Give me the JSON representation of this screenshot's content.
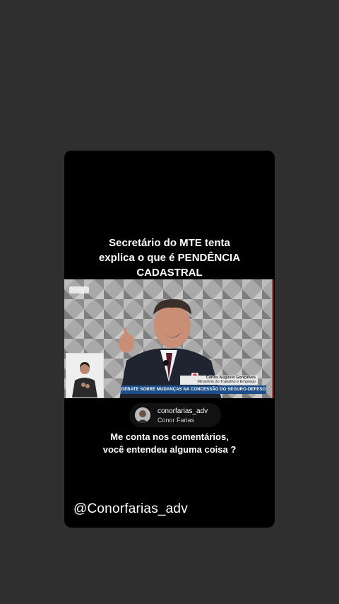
{
  "post": {
    "headline_lines": [
      "Secretário do MTE tenta",
      "explica o que é PENDÊNCIA",
      "CADASTRAL"
    ],
    "headline_emoji": "👇🏻",
    "video": {
      "speaker_name": "Carlos Augusto Gonçalves",
      "speaker_role": "Ministério do Trabalho e Emprego",
      "banner": "DEBATE SOBRE MUDANÇAS NA CONCESSÃO DO SEGURO-DEFESO"
    },
    "profile": {
      "handle": "conorfarias_adv",
      "name": "Conor Farias"
    },
    "caption_lines": [
      "Me conta nos comentários,",
      "você entendeu alguma coisa ?"
    ],
    "watermark": "@Conorfarias_adv"
  }
}
